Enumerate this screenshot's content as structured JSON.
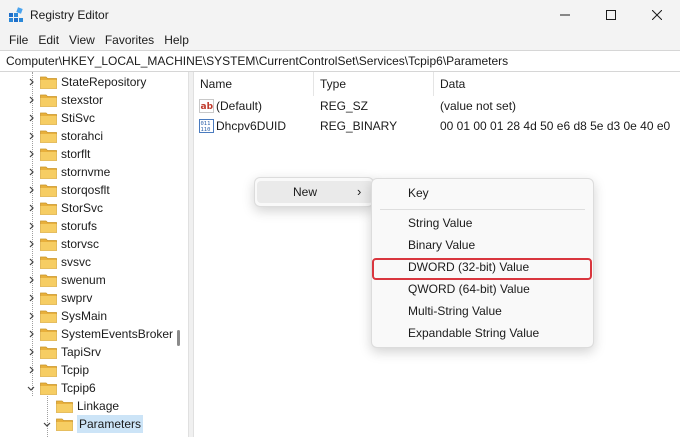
{
  "window": {
    "title": "Registry Editor"
  },
  "menubar": {
    "items": [
      "File",
      "Edit",
      "View",
      "Favorites",
      "Help"
    ]
  },
  "address": {
    "path": "Computer\\HKEY_LOCAL_MACHINE\\SYSTEM\\CurrentControlSet\\Services\\Tcpip6\\Parameters"
  },
  "tree": {
    "items": [
      {
        "label": "StateRepository",
        "expander": "collapsed"
      },
      {
        "label": "stexstor",
        "expander": "collapsed"
      },
      {
        "label": "StiSvc",
        "expander": "collapsed"
      },
      {
        "label": "storahci",
        "expander": "collapsed"
      },
      {
        "label": "storflt",
        "expander": "collapsed"
      },
      {
        "label": "stornvme",
        "expander": "collapsed"
      },
      {
        "label": "storqosflt",
        "expander": "collapsed"
      },
      {
        "label": "StorSvc",
        "expander": "collapsed"
      },
      {
        "label": "storufs",
        "expander": "collapsed"
      },
      {
        "label": "storvsc",
        "expander": "collapsed"
      },
      {
        "label": "svsvc",
        "expander": "collapsed"
      },
      {
        "label": "swenum",
        "expander": "collapsed"
      },
      {
        "label": "swprv",
        "expander": "collapsed"
      },
      {
        "label": "SysMain",
        "expander": "collapsed"
      },
      {
        "label": "SystemEventsBroker",
        "expander": "collapsed"
      },
      {
        "label": "TapiSrv",
        "expander": "collapsed"
      },
      {
        "label": "Tcpip",
        "expander": "collapsed"
      },
      {
        "label": "Tcpip6",
        "expander": "expanded"
      },
      {
        "label": "Linkage",
        "expander": "none"
      },
      {
        "label": "Parameters",
        "expander": "expanded",
        "selected": true
      }
    ]
  },
  "values_pane": {
    "columns": [
      "Name",
      "Type",
      "Data"
    ],
    "rows": [
      {
        "name": "(Default)",
        "type": "REG_SZ",
        "data": "(value not set)",
        "icon": "string-value-icon"
      },
      {
        "name": "Dhcpv6DUID",
        "type": "REG_BINARY",
        "data": "00 01 00 01 28 4d 50 e6 d8 5e d3 0e 40 e0",
        "icon": "binary-value-icon"
      }
    ]
  },
  "context_menu": {
    "new_label": "New",
    "arrow": "›"
  },
  "submenu": {
    "key_label": "Key",
    "items": [
      "String Value",
      "Binary Value",
      "DWORD (32-bit) Value",
      "QWORD (64-bit) Value",
      "Multi-String Value",
      "Expandable String Value"
    ],
    "highlighted": "DWORD (32-bit) Value"
  },
  "colors": {
    "folder": "#f2c14e",
    "highlight": "#d9363e",
    "selection": "#cce4f7"
  }
}
